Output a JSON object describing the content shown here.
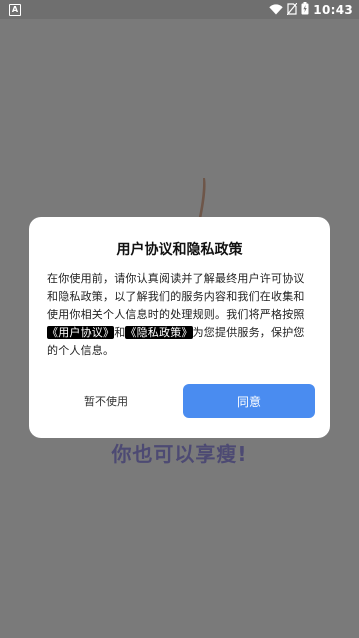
{
  "status_bar": {
    "time": "10:43",
    "left_icon": "notification-a-icon",
    "left_icon_text": "A",
    "icons": [
      "wifi-icon",
      "no-sim-icon",
      "battery-charging-icon"
    ]
  },
  "background": {
    "slogan": "你也可以享瘦!"
  },
  "dialog": {
    "title": "用户协议和隐私政策",
    "body_text_1": "在你使用前，请你认真阅读并了解最终用户许可协议和隐私政策，以了解我们的服务内容和我们在收集和使用你相关个人信息时的处理规则。我们将严格按照",
    "link_user_agreement": "《用户协议》",
    "body_text_2": "和",
    "link_privacy_policy": "《隐私政策》",
    "body_text_3": "为您提供服务，保护您的个人信息。",
    "cancel_label": "暂不使用",
    "agree_label": "同意"
  },
  "colors": {
    "overlay": "#7a7a7a",
    "dialog_bg": "#ffffff",
    "primary_button": "#4a8cf0",
    "slogan": "#4d4a73"
  }
}
